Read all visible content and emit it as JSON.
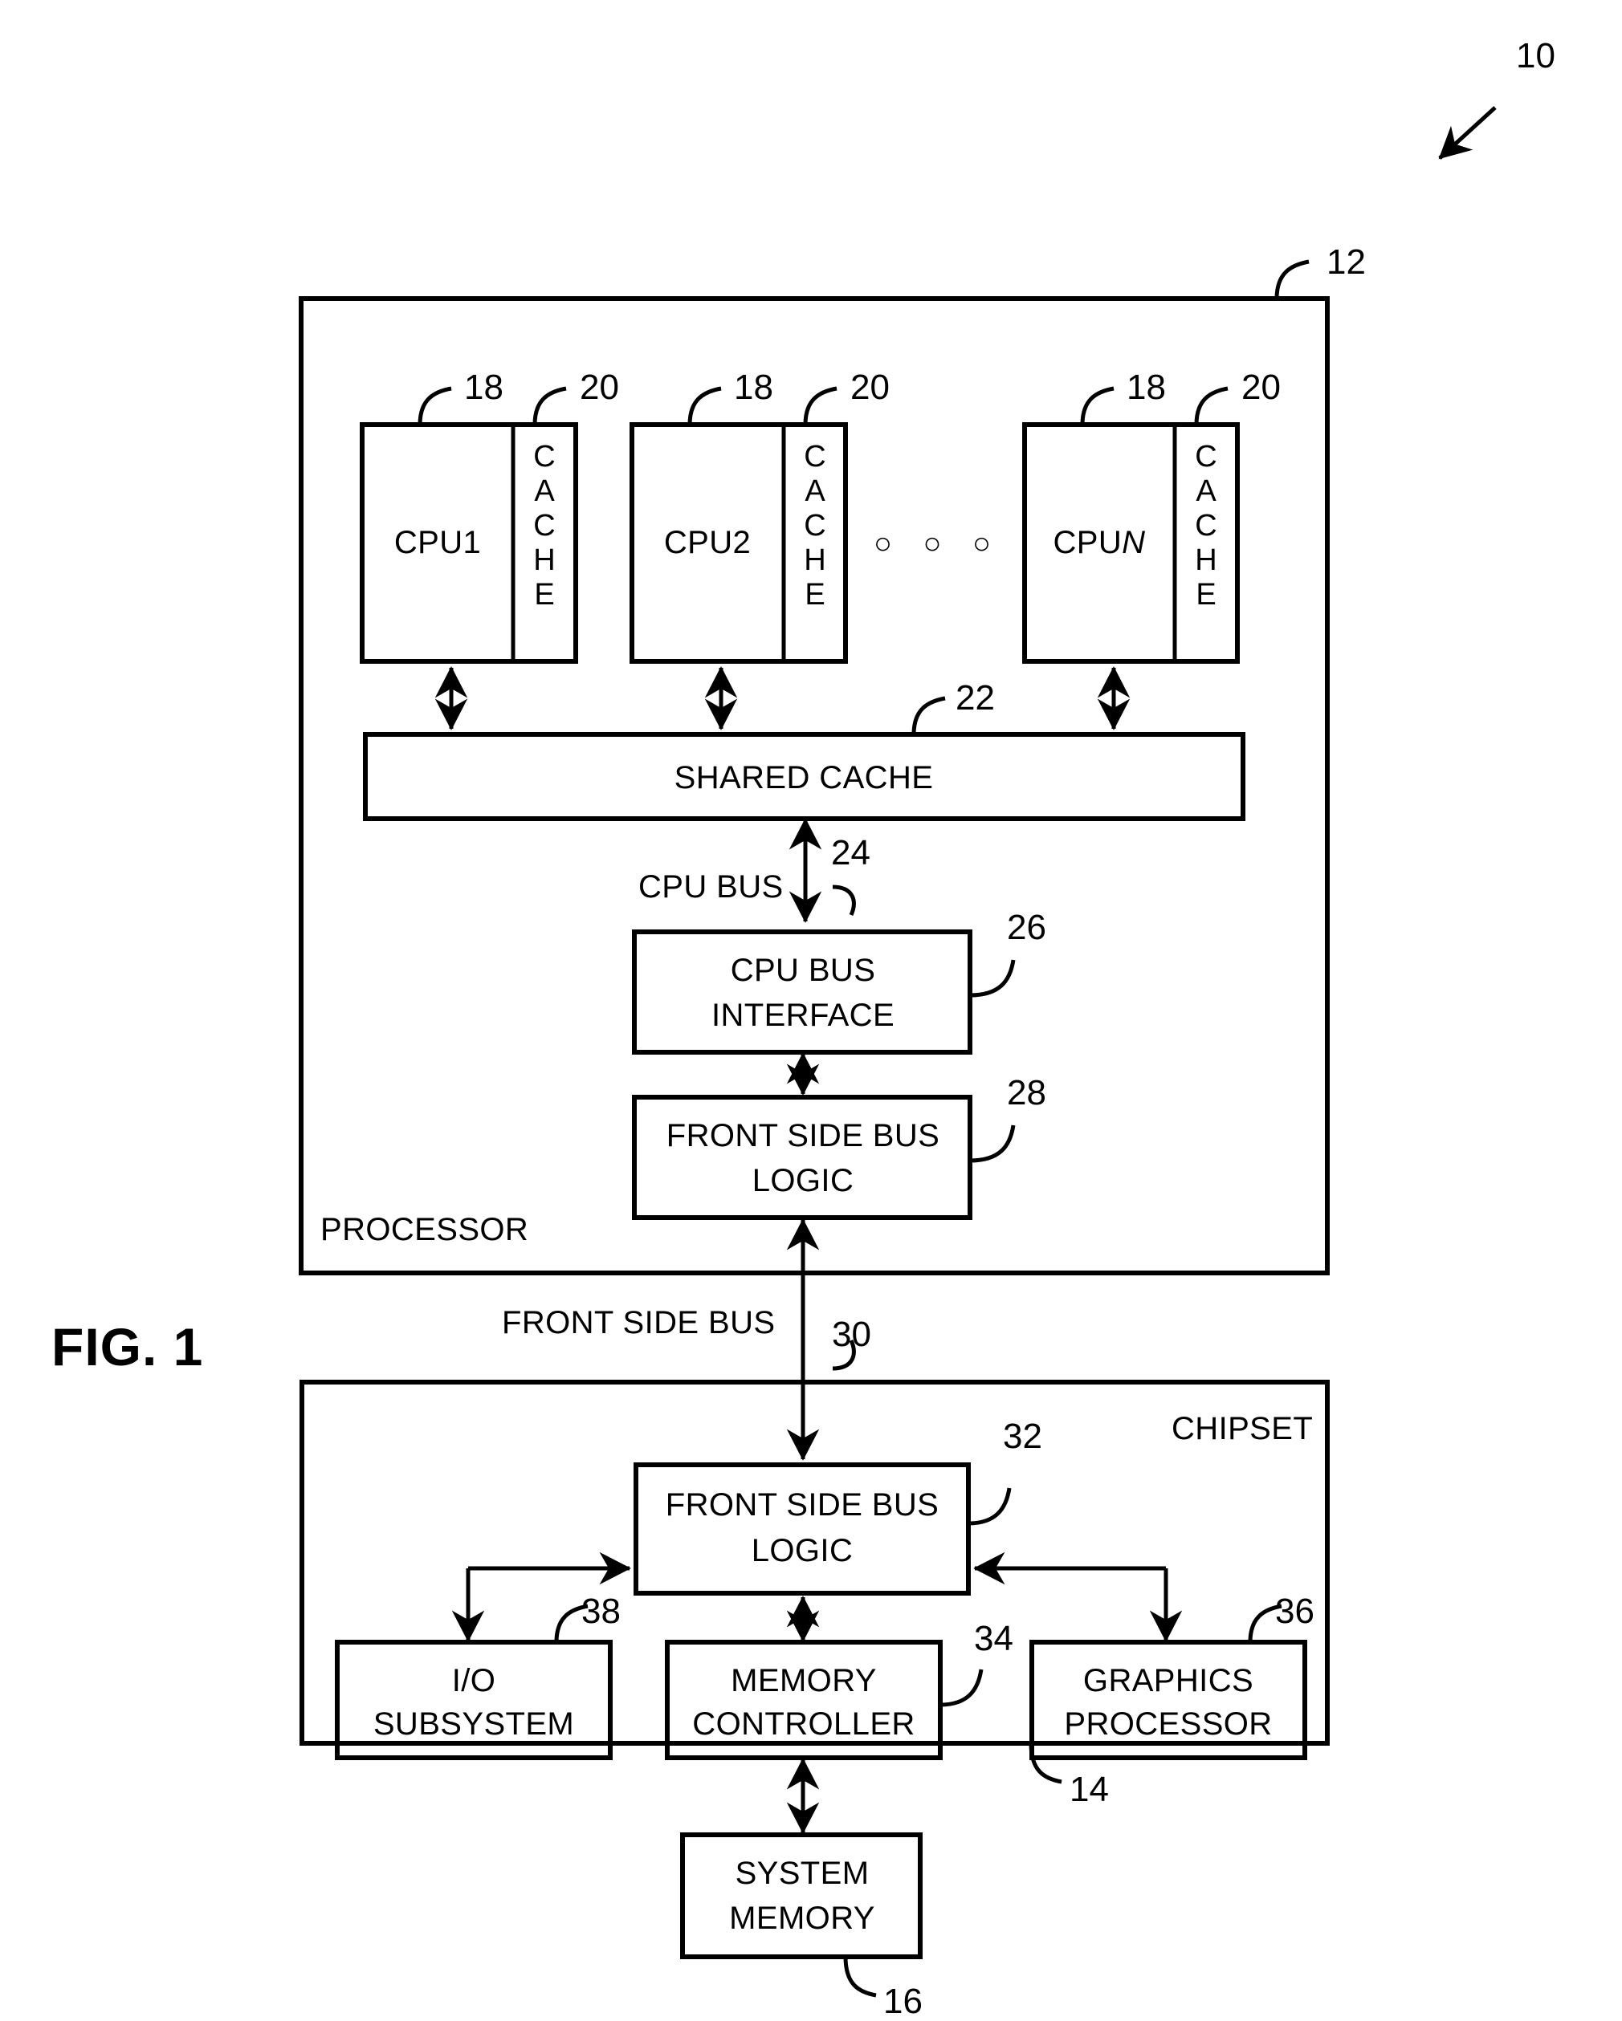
{
  "figure": {
    "label": "FIG. 1",
    "system_ref": "10"
  },
  "processor": {
    "title": "PROCESSOR",
    "ref": "12",
    "cpus": [
      {
        "name": "CPU1",
        "cpu_ref": "18",
        "cache_label": "CACHE",
        "cache_ref": "20"
      },
      {
        "name": "CPU2",
        "cpu_ref": "18",
        "cache_label": "CACHE",
        "cache_ref": "20"
      },
      {
        "name": "CPUN",
        "name_prefix": "CPU",
        "name_italic": "N",
        "cpu_ref": "18",
        "cache_label": "CACHE",
        "cache_ref": "20"
      }
    ],
    "ellipsis": "○ ○ ○",
    "shared_cache": {
      "label": "SHARED CACHE",
      "ref": "22"
    },
    "cpu_bus": {
      "label": "CPU BUS",
      "ref": "24"
    },
    "cpu_bus_interface": {
      "line1": "CPU BUS",
      "line2": "INTERFACE",
      "ref": "26"
    },
    "front_side_bus_logic": {
      "line1": "FRONT SIDE BUS",
      "line2": "LOGIC",
      "ref": "28"
    }
  },
  "front_side_bus": {
    "label": "FRONT SIDE BUS",
    "ref": "30"
  },
  "chipset": {
    "title": "CHIPSET",
    "ref": "14",
    "front_side_bus_logic": {
      "line1": "FRONT SIDE BUS",
      "line2": "LOGIC",
      "ref": "32"
    },
    "io_subsystem": {
      "line1": "I/O",
      "line2": "SUBSYSTEM",
      "ref": "38"
    },
    "memory_controller": {
      "line1": "MEMORY",
      "line2": "CONTROLLER",
      "ref": "34"
    },
    "graphics_processor": {
      "line1": "GRAPHICS",
      "line2": "PROCESSOR",
      "ref": "36"
    }
  },
  "system_memory": {
    "line1": "SYSTEM",
    "line2": "MEMORY",
    "ref": "16"
  },
  "colors": {
    "ink": "#000000",
    "paper": "#ffffff"
  }
}
